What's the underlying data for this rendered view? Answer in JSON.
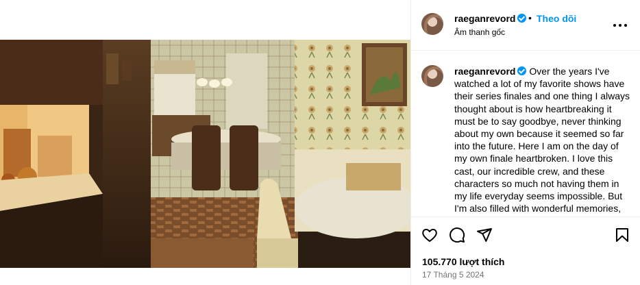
{
  "post": {
    "username": "raeganrevord",
    "verified": true,
    "separator": "•",
    "follow_label": "Theo dõi",
    "audio_label": "Âm thanh gốc",
    "caption": "Over the years I've watched a lot of my favorite shows have their series finales and one thing I always thought about is how heartbreaking it must be to say goodbye, never thinking about my own because it seemed so far into the future. Here I am on the day of my own finale heartbroken. I love this cast, our incredible crew, and these characters so much not having them in my life everyday seems impossible. But I'm also filled with wonderful memories, and gratefulness",
    "likes": "105.770 lượt thích",
    "date": "17 Tháng 5 2024"
  },
  "media": {
    "type": "video",
    "muted": true
  },
  "icons": [
    "verified-badge-icon",
    "more-options-icon",
    "mute-icon",
    "heart-icon",
    "comment-icon",
    "share-icon",
    "bookmark-icon"
  ],
  "colors": {
    "accent": "#0095f6",
    "secondary_text": "#737373",
    "border": "#efefef"
  }
}
